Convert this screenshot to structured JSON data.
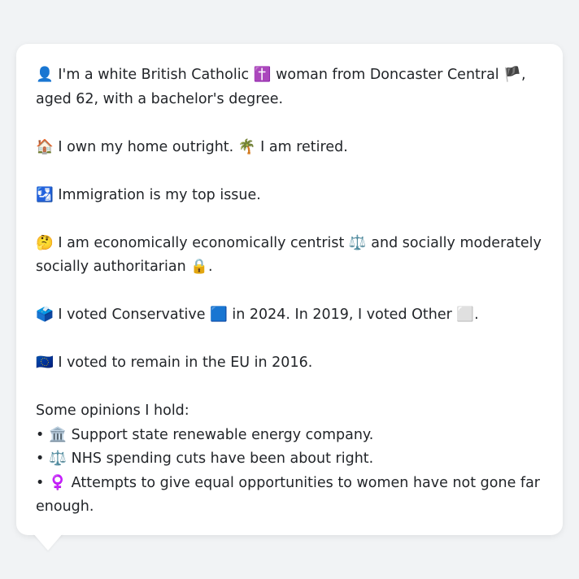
{
  "profile": {
    "line1": "👤 I'm a white British Catholic ✝️ woman from Doncaster Central 🏴, aged 62, with a bachelor's degree.",
    "line2": "🏠 I own my home outright. 🌴 I am retired.",
    "line3": "🛂 Immigration is my top issue.",
    "line4": "🤔 I am economically economically centrist ⚖️ and socially moderately socially authoritarian 🔒.",
    "line5": "🗳️ I voted Conservative 🟦 in 2024. In 2019, I voted Other ⬜.",
    "line6": "🇪🇺 I voted to remain in the EU in 2016."
  },
  "opinions": {
    "heading": "Some opinions I hold:",
    "bullet": "•",
    "items": [
      "🏛️ Support state renewable energy company.",
      "⚖️ NHS spending cuts have been about right.",
      "♀️ Attempts to give equal opportunities to women have not gone far enough."
    ]
  }
}
